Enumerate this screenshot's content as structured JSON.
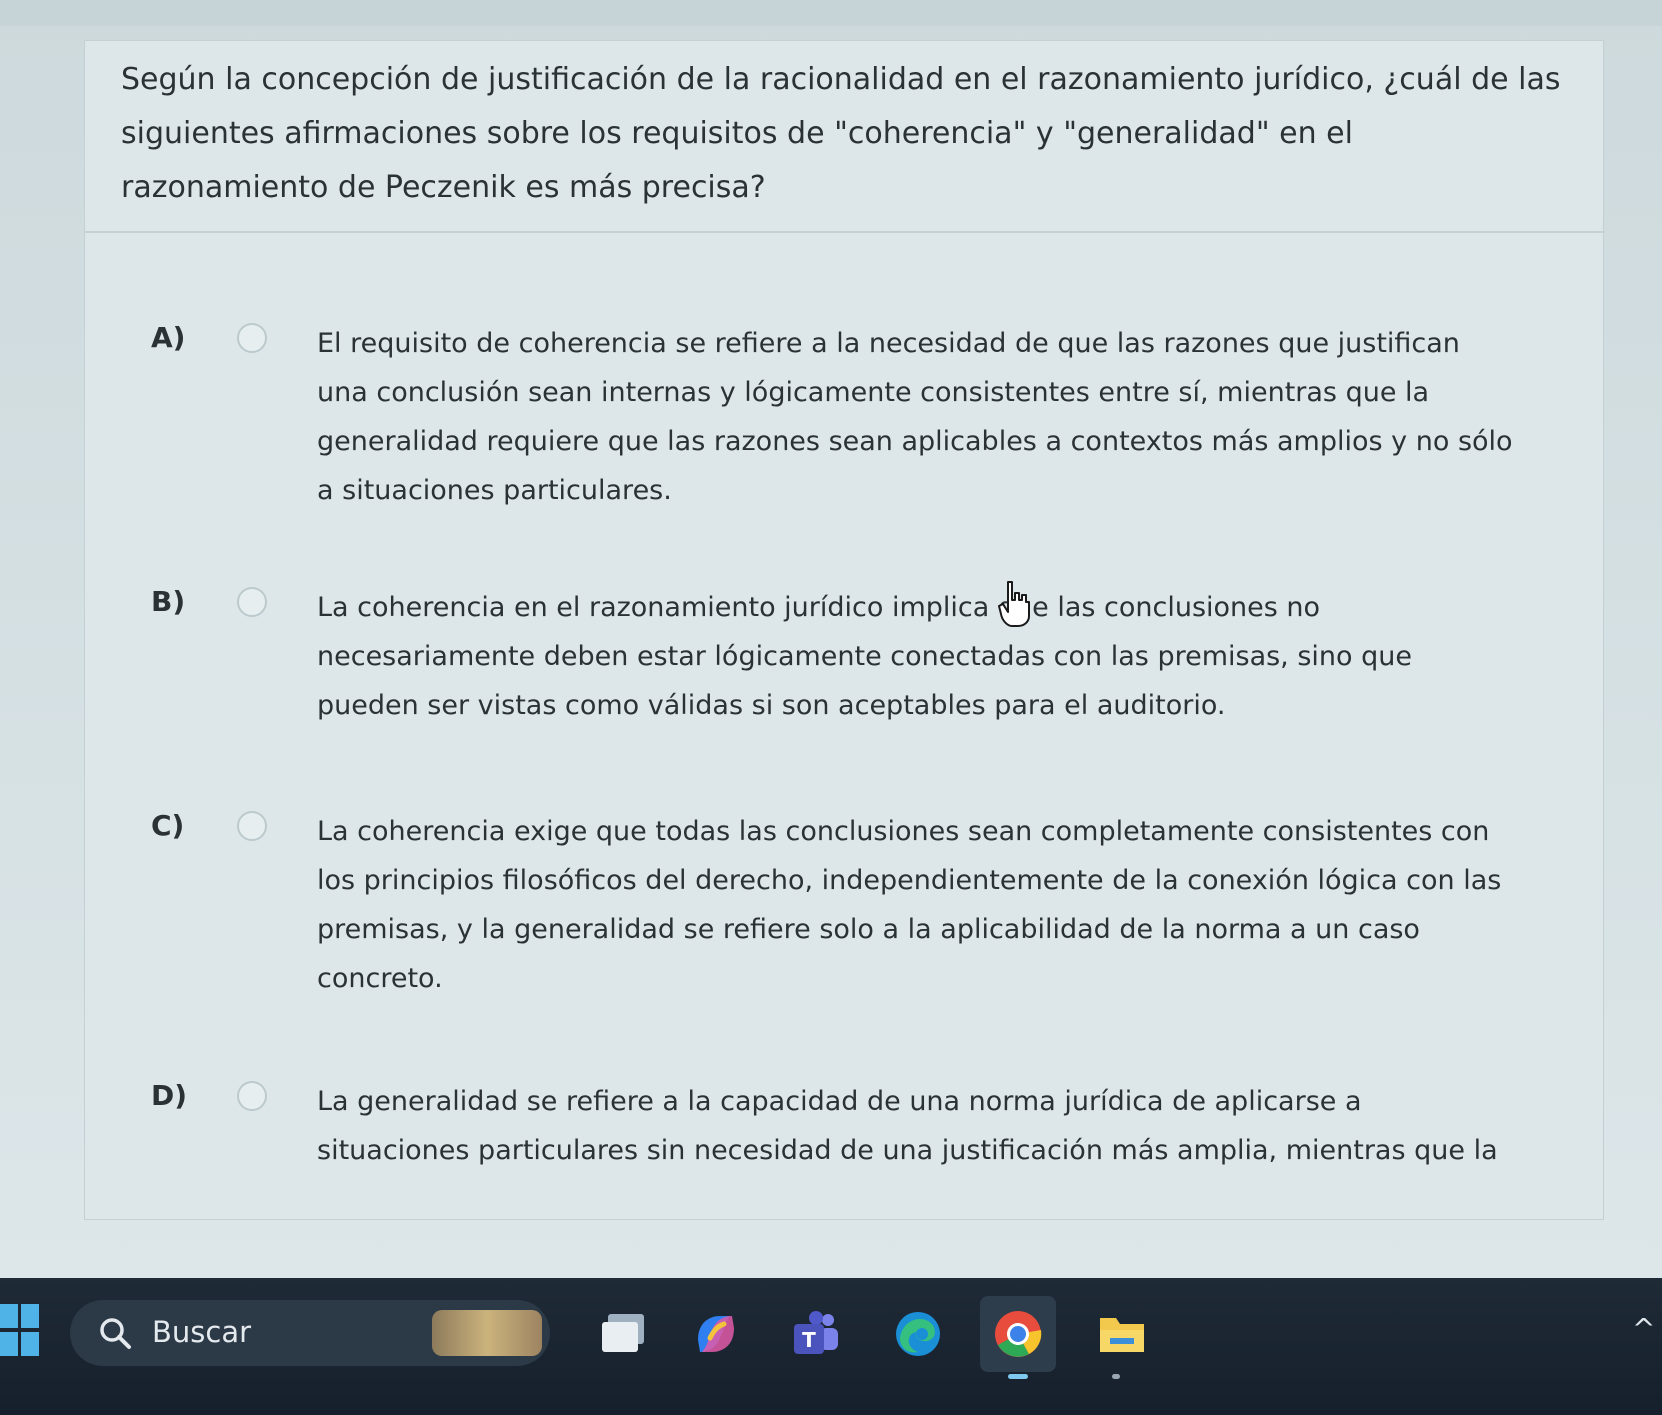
{
  "quiz": {
    "question": "Según la concepción de justificación de la racionalidad en el razonamiento jurídico, ¿cuál de las siguientes afirmaciones sobre los requisitos de \"coherencia\" y \"generalidad\" en el razonamiento de Peczenik es más precisa?",
    "options": [
      {
        "letter": "A)",
        "text": "El requisito de coherencia se refiere a la necesidad de que las razones que justifican una conclusión sean internas y lógicamente consistentes entre sí, mientras que la generalidad requiere que las razones sean aplicables a contextos más amplios y no sólo a situaciones particulares."
      },
      {
        "letter": "B)",
        "text": "La coherencia en el razonamiento jurídico implica que las conclusiones no necesariamente deben estar lógicamente conectadas con las premisas, sino que pueden ser vistas como válidas si son aceptables para el auditorio."
      },
      {
        "letter": "C)",
        "text": "La coherencia exige que todas las conclusiones sean completamente consistentes con los principios filosóficos del derecho, independientemente de la conexión lógica con las premisas, y la generalidad se refiere solo a la aplicabilidad de la norma a un caso concreto."
      },
      {
        "letter": "D)",
        "text": "La generalidad se refiere a la capacidad de una norma jurídica de aplicarse a situaciones particulares sin necesidad de una justificación más amplia, mientras que la"
      }
    ]
  },
  "taskbar": {
    "search_label": "Buscar",
    "pinned_icons": [
      "task-view-icon",
      "copilot-icon",
      "teams-icon",
      "edge-icon",
      "chrome-icon",
      "file-explorer-icon"
    ]
  },
  "colors": {
    "card_background": "#dde7e9",
    "text": "#2b3236",
    "taskbar": "#1f2a37",
    "windows_blue": "#4fb3e8"
  }
}
